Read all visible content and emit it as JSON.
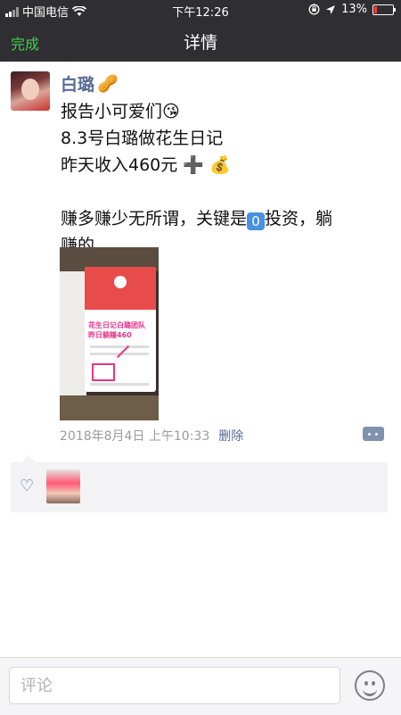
{
  "status_bar": {
    "carrier": "中国电信",
    "time": "下午12:26",
    "battery": "13%",
    "battery_level": 0.13
  },
  "nav": {
    "done_label": "完成",
    "title": "详情"
  },
  "post": {
    "author": "白璐",
    "lines": {
      "l1": "报告小可爱们",
      "l2": "8.3号白璐做花生日记",
      "l3": "昨天收入460元",
      "l4": "赚多赚少无所谓，关键是",
      "l4b": "投资，躺",
      "l5": "赚的"
    },
    "emojis": {
      "kiss": "😘",
      "plus": "➕",
      "bag": "💰",
      "zero": "0"
    },
    "image_text": {
      "caption_line1": "花生日记白璐团队",
      "caption_line2": "昨日躺赚460"
    },
    "date": "2018年8月4日 上午10:33",
    "delete_label": "删除"
  },
  "comment_bar": {
    "placeholder": "评论"
  },
  "colors": {
    "nav_bg": "#2e2e33",
    "done_green": "#3fd04a",
    "link_blue": "#576b95"
  },
  "icons": [
    "wifi-icon",
    "lock-rotation-icon",
    "location-arrow-icon",
    "battery-icon",
    "heart-icon",
    "comment-dots-icon",
    "emoji-face-icon"
  ]
}
